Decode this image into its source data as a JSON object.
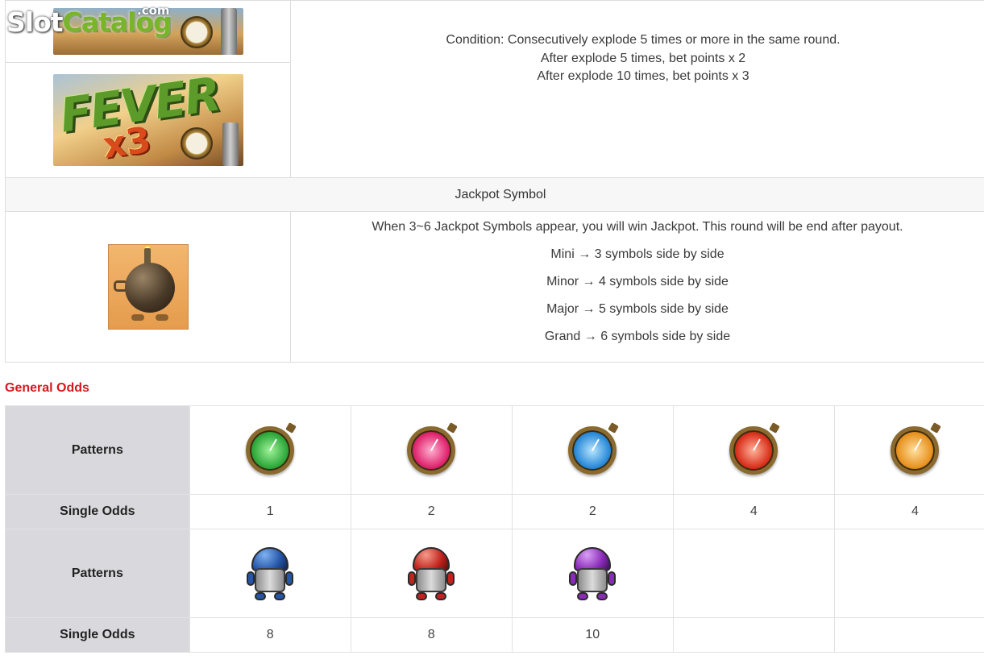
{
  "watermark": {
    "brand_slot": "Slot",
    "brand_catalog": "Catalog",
    "brand_domain": ".com"
  },
  "fever": {
    "condition": "Condition: Consecutively explode 5 times or more in the same round.",
    "rule_5": "After explode 5 times, bet points x 2",
    "rule_10": "After explode 10 times, bet points x 3",
    "banner_word": "FEVER",
    "banner_multiplier": "x3"
  },
  "jackpot": {
    "heading": "Jackpot Symbol",
    "description": "When 3~6 Jackpot Symbols appear, you will win Jackpot. This round will be end after payout.",
    "tiers": [
      {
        "text": "Mini → 3 symbols side by side"
      },
      {
        "text": "Minor → 4 symbols side by side"
      },
      {
        "text": "Major → 5 symbols side by side"
      },
      {
        "text": "Grand → 6 symbols side by side"
      }
    ]
  },
  "general_odds": {
    "title": "General Odds",
    "rows": [
      {
        "pattern_label": "Patterns",
        "odds_label": "Single Odds",
        "symbols": [
          {
            "icon": "green-clock-icon",
            "color": "#2ea83a",
            "odds": "1"
          },
          {
            "icon": "pink-clock-icon",
            "color": "#e0246e",
            "odds": "2"
          },
          {
            "icon": "blue-clock-icon",
            "color": "#2a8ad8",
            "odds": "2"
          },
          {
            "icon": "red-clock-icon",
            "color": "#d9301c",
            "odds": "4"
          },
          {
            "icon": "orange-clock-icon",
            "color": "#e89220",
            "odds": "4"
          }
        ]
      },
      {
        "pattern_label": "Patterns",
        "odds_label": "Single Odds",
        "symbols": [
          {
            "icon": "blue-robot-icon",
            "color": "#2456a8",
            "odds": "8"
          },
          {
            "icon": "red-robot-icon",
            "color": "#c0231c",
            "odds": "8"
          },
          {
            "icon": "purple-robot-icon",
            "color": "#8a2ab8",
            "odds": "10"
          }
        ]
      }
    ]
  }
}
